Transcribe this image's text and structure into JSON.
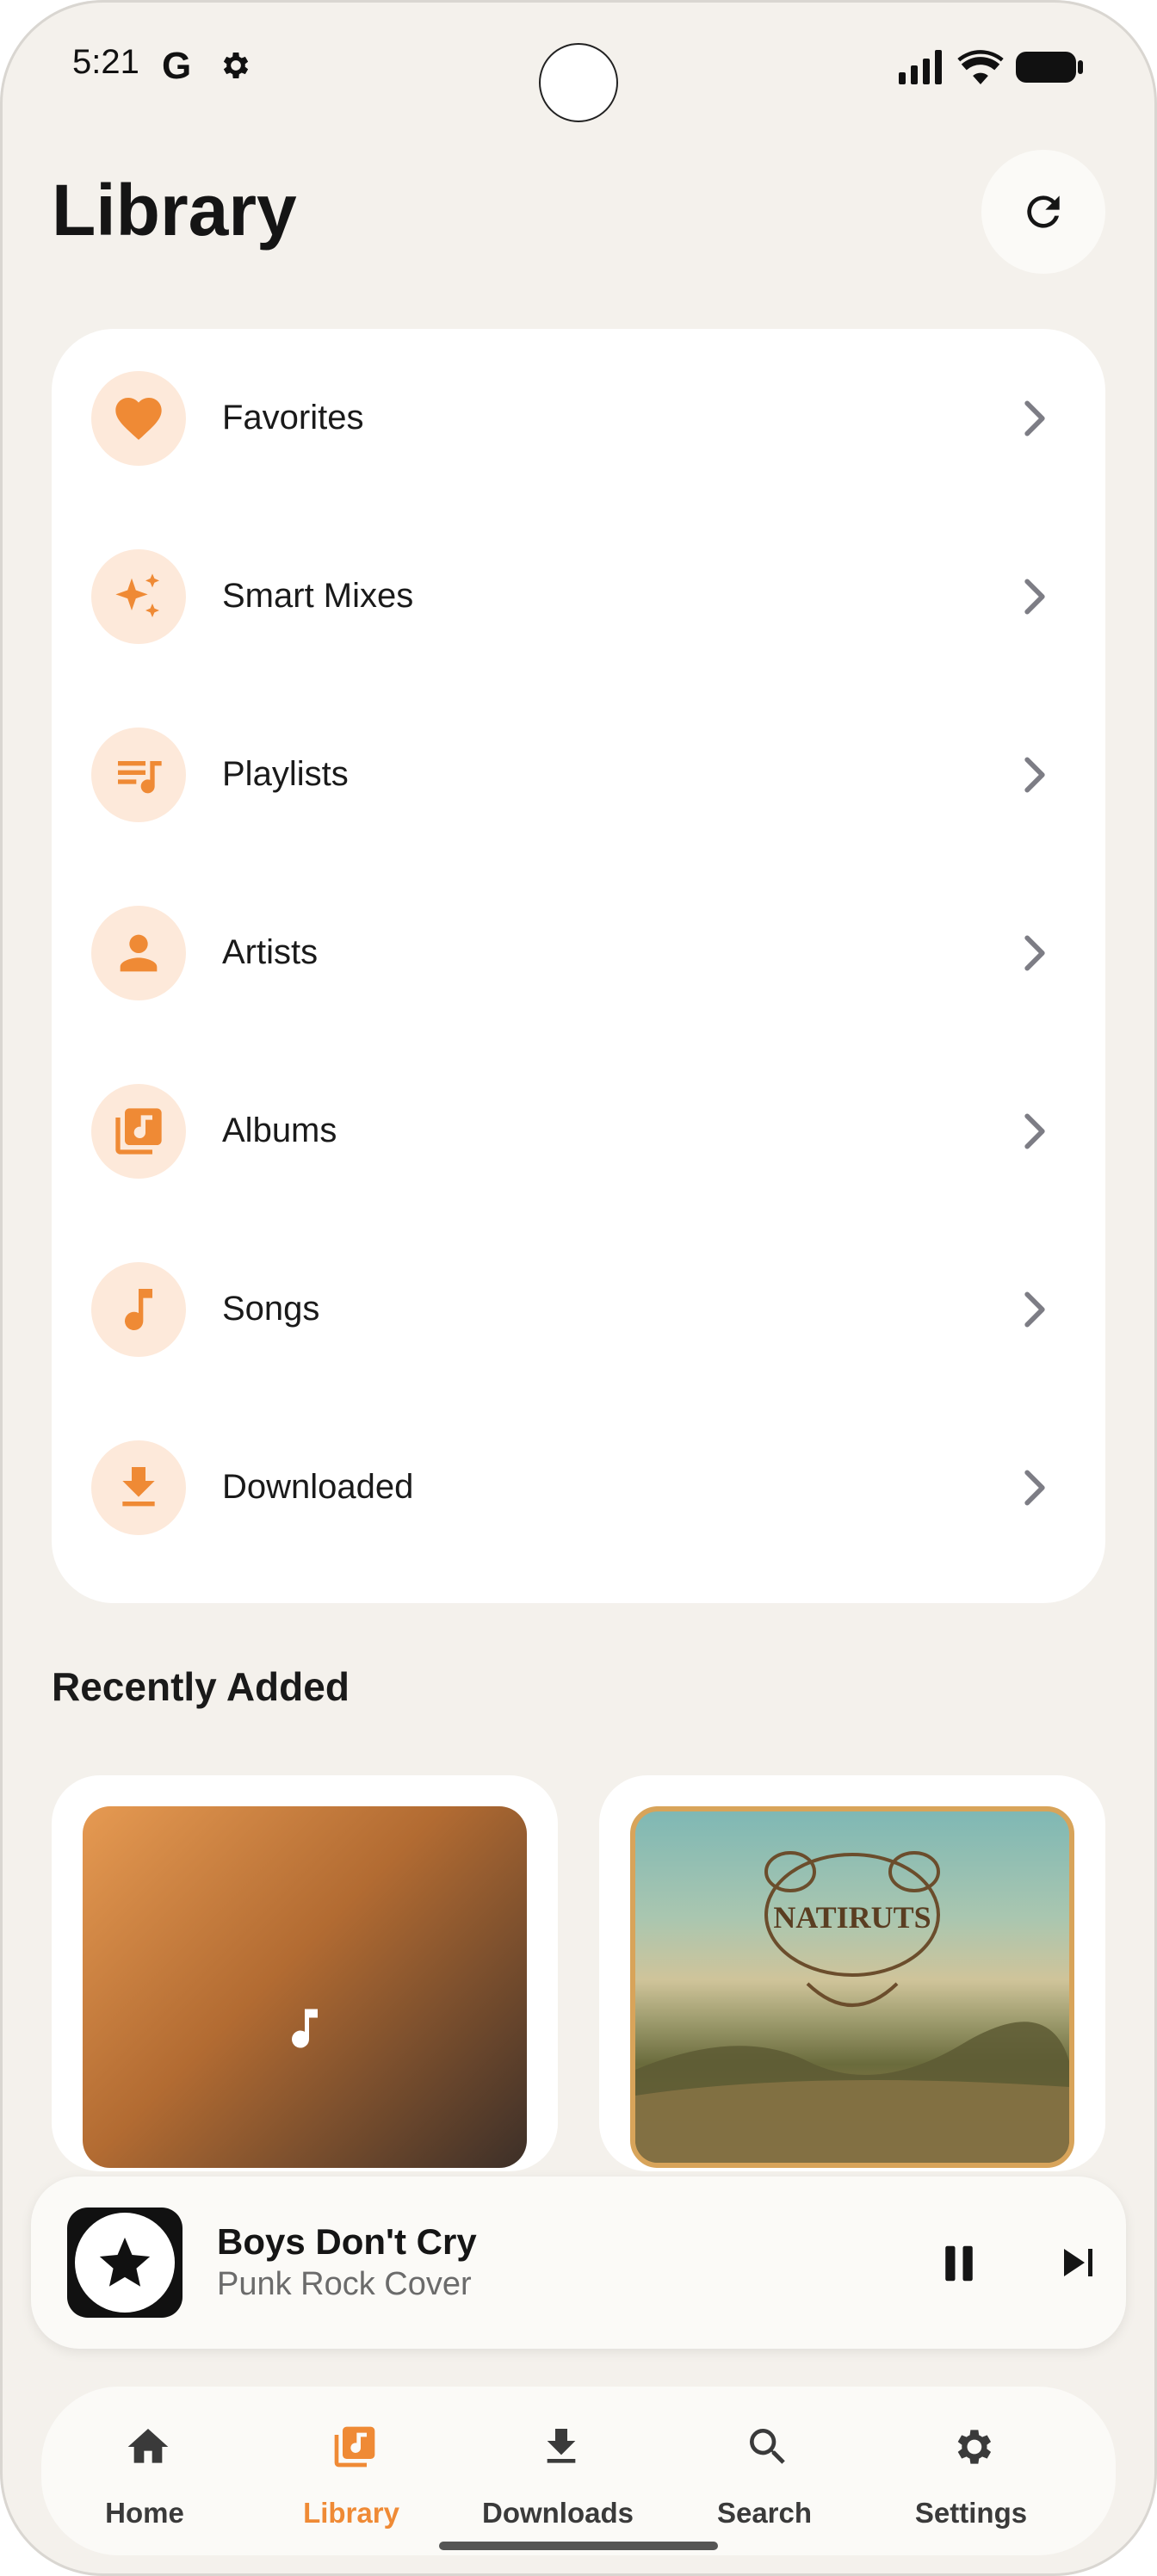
{
  "status_bar": {
    "time": "5:21",
    "g_label": "G"
  },
  "header": {
    "title": "Library"
  },
  "menu": [
    {
      "label": "Favorites",
      "icon": "heart-icon"
    },
    {
      "label": "Smart Mixes",
      "icon": "sparkles-icon"
    },
    {
      "label": "Playlists",
      "icon": "playlist-icon"
    },
    {
      "label": "Artists",
      "icon": "person-icon"
    },
    {
      "label": "Albums",
      "icon": "album-icon"
    },
    {
      "label": "Songs",
      "icon": "music-note-icon"
    },
    {
      "label": "Downloaded",
      "icon": "download-icon"
    }
  ],
  "recently_added": {
    "title": "Recently Added",
    "album_2_art_text": "NATIRUTS"
  },
  "now_playing": {
    "title": "Boys Don't Cry",
    "artist": "Punk Rock Cover"
  },
  "bottom_nav": [
    {
      "label": "Home",
      "icon": "home-icon",
      "active": false
    },
    {
      "label": "Library",
      "icon": "library-icon",
      "active": true
    },
    {
      "label": "Downloads",
      "icon": "download-icon",
      "active": false
    },
    {
      "label": "Search",
      "icon": "search-icon",
      "active": false
    },
    {
      "label": "Settings",
      "icon": "settings-icon",
      "active": false
    }
  ],
  "colors": {
    "accent": "#ef8a35",
    "icon_bg": "#fde9da",
    "background": "#f4f1ec"
  }
}
